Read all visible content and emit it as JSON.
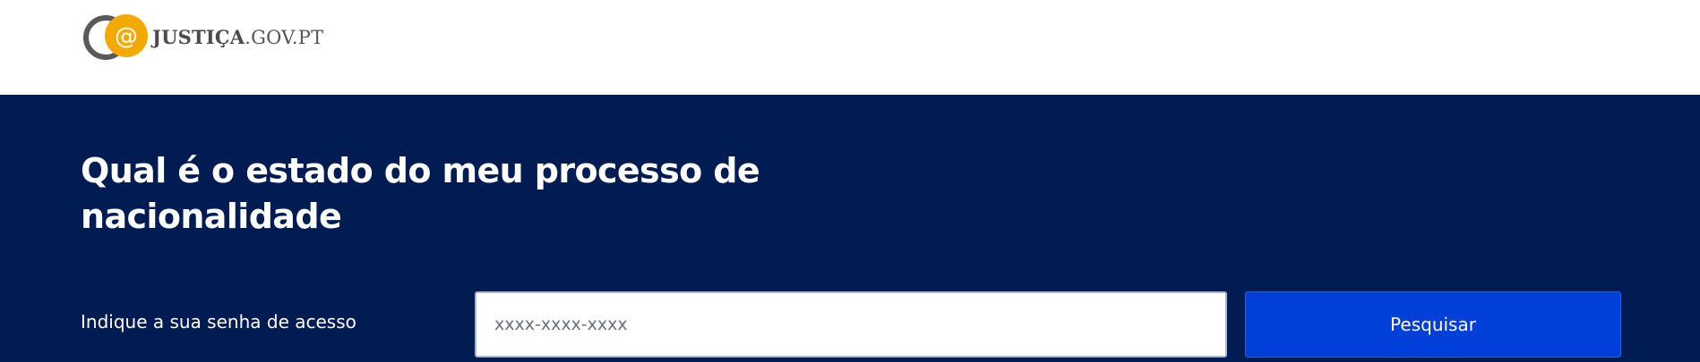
{
  "header": {
    "logo": {
      "icon": "at-sign-logo-icon",
      "text_bold": "JUSTIÇA",
      "text_regular": ".GOV.PT",
      "colors": {
        "ring": "#5a5a5a",
        "circle": "#f2a900"
      }
    }
  },
  "hero": {
    "title": "Qual é o estado do meu processo de nacionalidade",
    "background_color": "#001c52"
  },
  "form": {
    "label": "Indique a sua senha de acesso",
    "input_placeholder": "xxxx-xxxx-xxxx",
    "input_value": "",
    "button_label": "Pesquisar",
    "button_color": "#0040d8"
  }
}
